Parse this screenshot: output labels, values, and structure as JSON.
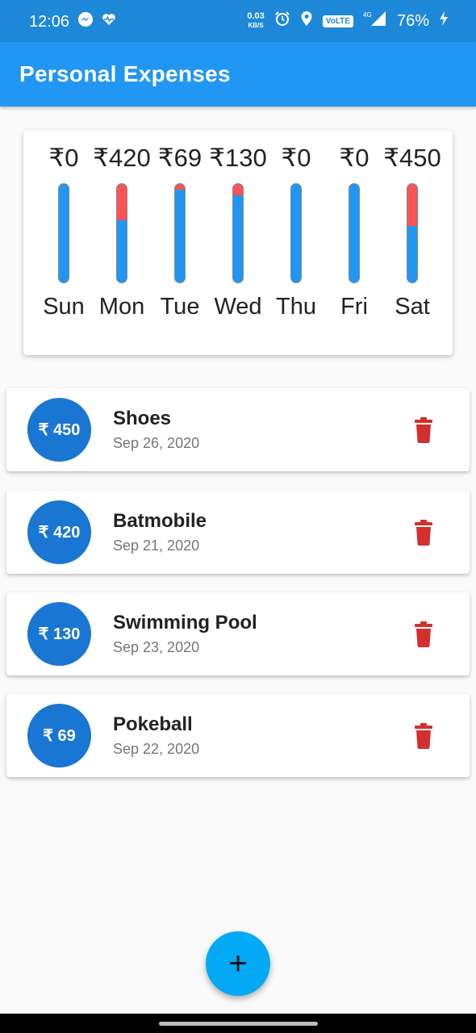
{
  "status_bar": {
    "time": "12:06",
    "net_speed_value": "0.03",
    "net_speed_unit": "KB/S",
    "volte": "VoLTE",
    "network": "4G",
    "battery": "76%"
  },
  "app_bar": {
    "title": "Personal Expenses"
  },
  "chart_data": {
    "type": "bar",
    "categories": [
      "Sun",
      "Mon",
      "Tue",
      "Wed",
      "Thu",
      "Fri",
      "Sat"
    ],
    "values": [
      0,
      420,
      69,
      130,
      0,
      0,
      450
    ],
    "value_labels": [
      "₹0",
      "₹420",
      "₹69",
      "₹130",
      "₹0",
      "₹0",
      "₹450"
    ],
    "fraction_of_total": [
      0,
      0.36,
      0.06,
      0.11,
      0,
      0,
      0.42
    ],
    "colors": {
      "fill": "#ff5252",
      "track": "#2196f3"
    }
  },
  "transactions": [
    {
      "amount": "₹ 450",
      "title": "Shoes",
      "date": "Sep 26, 2020"
    },
    {
      "amount": "₹ 420",
      "title": "Batmobile",
      "date": "Sep 21, 2020"
    },
    {
      "amount": "₹ 130",
      "title": "Swimming Pool",
      "date": "Sep 23, 2020"
    },
    {
      "amount": "₹ 69",
      "title": "Pokeball",
      "date": "Sep 22, 2020"
    }
  ],
  "fab": {
    "label": "+"
  },
  "colors": {
    "primary": "#2196f3",
    "avatar": "#1976d2",
    "delete": "#d32f2f",
    "fab": "#03a9f4"
  }
}
